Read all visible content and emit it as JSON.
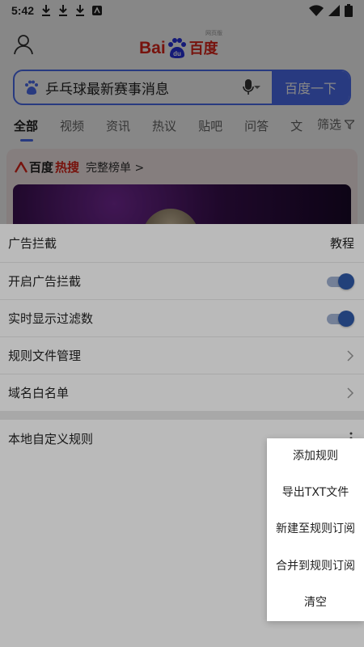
{
  "status_bar": {
    "time": "5:42",
    "notification_icons": [
      "download-icon",
      "download-icon",
      "download-icon",
      "app-icon"
    ],
    "system_icons": [
      "wifi-icon",
      "signal-icon",
      "battery-icon"
    ]
  },
  "baidu": {
    "logo_text_latin": "Bai",
    "logo_text_du": "du",
    "logo_text_cn": "百度",
    "logo_tiny": "网页版",
    "search_query": "乒乓球最新赛事消息",
    "search_button": "百度一下",
    "tabs": [
      "全部",
      "视频",
      "资讯",
      "热议",
      "贴吧",
      "问答",
      "文"
    ],
    "filter_label": "筛选",
    "hot_brand_1": "百度",
    "hot_brand_2": "热搜",
    "hot_more": "完整榜单 >"
  },
  "sheet": {
    "title": "广告拦截",
    "help": "教程",
    "rows": [
      {
        "label": "开启广告拦截",
        "toggle": true
      },
      {
        "label": "实时显示过滤数",
        "toggle": true
      },
      {
        "label": "规则文件管理"
      },
      {
        "label": "域名白名单"
      }
    ],
    "local_rules_label": "本地自定义规则"
  },
  "popup_menu": {
    "items": [
      "添加规则",
      "导出TXT文件",
      "新建至规则订阅",
      "合并到规则订阅",
      "清空"
    ]
  },
  "colors": {
    "accent": "#4e6ef2",
    "baidu_red": "#e1251b",
    "toggle_on": "#2f5aa8"
  }
}
